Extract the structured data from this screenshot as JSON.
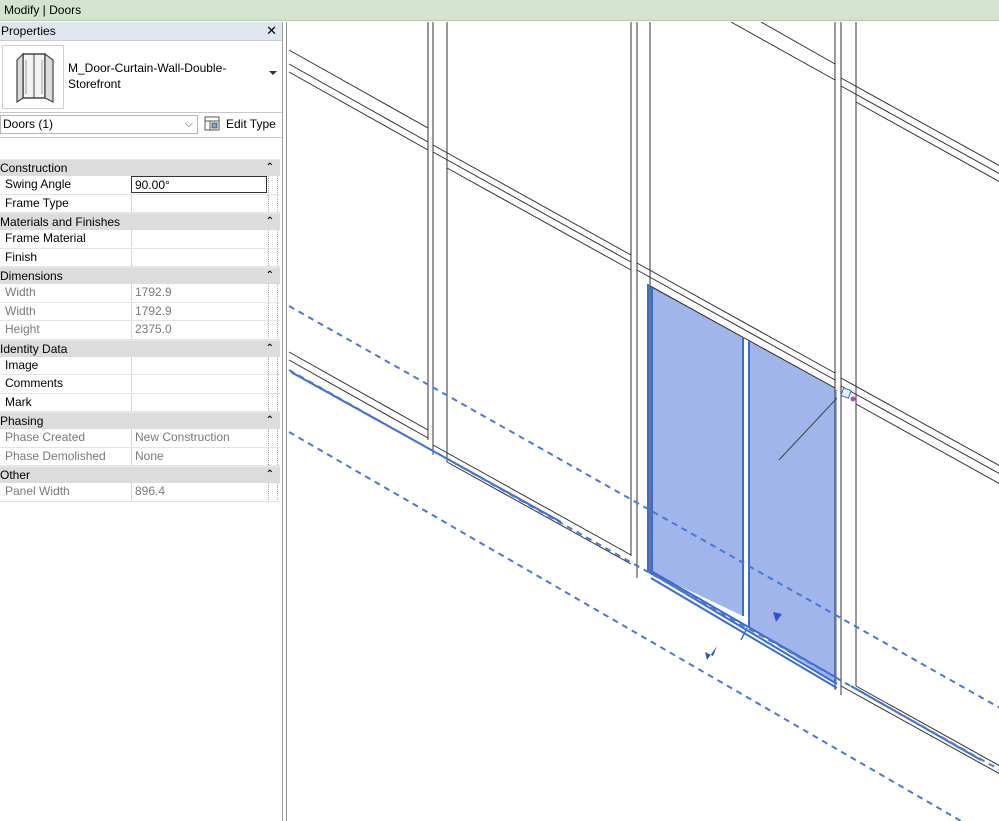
{
  "titlebar": {
    "title": "Modify | Doors"
  },
  "properties": {
    "header": "Properties",
    "close_icon": "close-icon",
    "type_name": "M_Door-Curtain-Wall-Double-Storefront",
    "filter": "Doors (1)",
    "edit_type": "Edit Type",
    "categories": [
      {
        "label": "Construction",
        "rows": [
          {
            "name": "Swing Angle",
            "value": "90.00°",
            "state": "edit"
          },
          {
            "name": "Frame Type",
            "value": "",
            "state": "normal"
          }
        ]
      },
      {
        "label": "Materials and Finishes",
        "rows": [
          {
            "name": "Frame Material",
            "value": "",
            "state": "normal"
          },
          {
            "name": "Finish",
            "value": "",
            "state": "normal"
          }
        ]
      },
      {
        "label": "Dimensions",
        "rows": [
          {
            "name": "Width",
            "value": "1792.9",
            "state": "gray"
          },
          {
            "name": "Width",
            "value": "1792.9",
            "state": "gray"
          },
          {
            "name": "Height",
            "value": "2375.0",
            "state": "gray"
          }
        ]
      },
      {
        "label": "Identity Data",
        "rows": [
          {
            "name": "Image",
            "value": "",
            "state": "normal"
          },
          {
            "name": "Comments",
            "value": "",
            "state": "normal"
          },
          {
            "name": "Mark",
            "value": "",
            "state": "normal"
          }
        ]
      },
      {
        "label": "Phasing",
        "rows": [
          {
            "name": "Phase Created",
            "value": "New Construction",
            "state": "gray"
          },
          {
            "name": "Phase Demolished",
            "value": "None",
            "state": "gray"
          }
        ]
      },
      {
        "label": "Other",
        "rows": [
          {
            "name": "Panel Width",
            "value": "896.4",
            "state": "gray"
          }
        ]
      }
    ]
  },
  "colors": {
    "selection": "#4f7be0",
    "titlebar_bg": "#d4e3cf"
  }
}
